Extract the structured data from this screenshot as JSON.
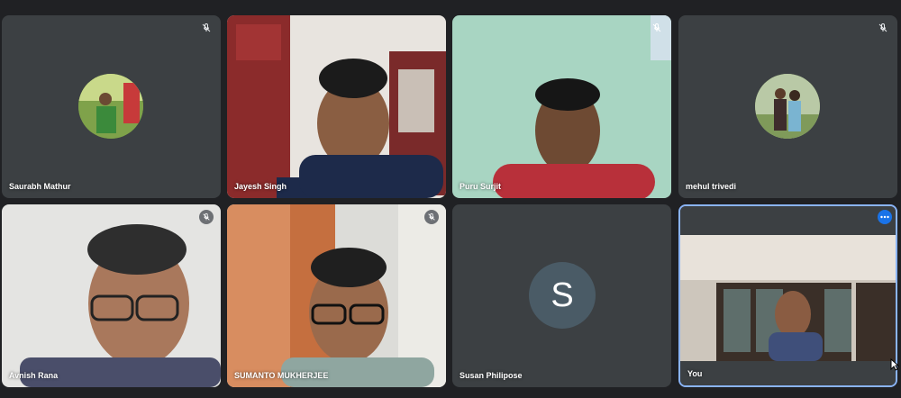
{
  "participants": [
    {
      "name": "Saurabh Mathur",
      "muted": true
    },
    {
      "name": "Jayesh Singh",
      "muted": false
    },
    {
      "name": "Puru Surjit",
      "muted": true
    },
    {
      "name": "mehul trivedi",
      "muted": true
    },
    {
      "name": "Avnish Rana",
      "muted": true
    },
    {
      "name": "SUMANTO MUKHERJEE",
      "muted": true
    },
    {
      "name": "Susan Philipose",
      "muted": false,
      "initial": "S"
    },
    {
      "name": "You",
      "muted": false
    }
  ],
  "icons": {
    "muted": "mic-off-icon",
    "more": "more-options-icon"
  },
  "colors": {
    "background": "#202124",
    "tile": "#3c4043",
    "active_border": "#8ab4f8",
    "letter_avatar": "#4a5b66",
    "more_button": "#1a73e8"
  }
}
